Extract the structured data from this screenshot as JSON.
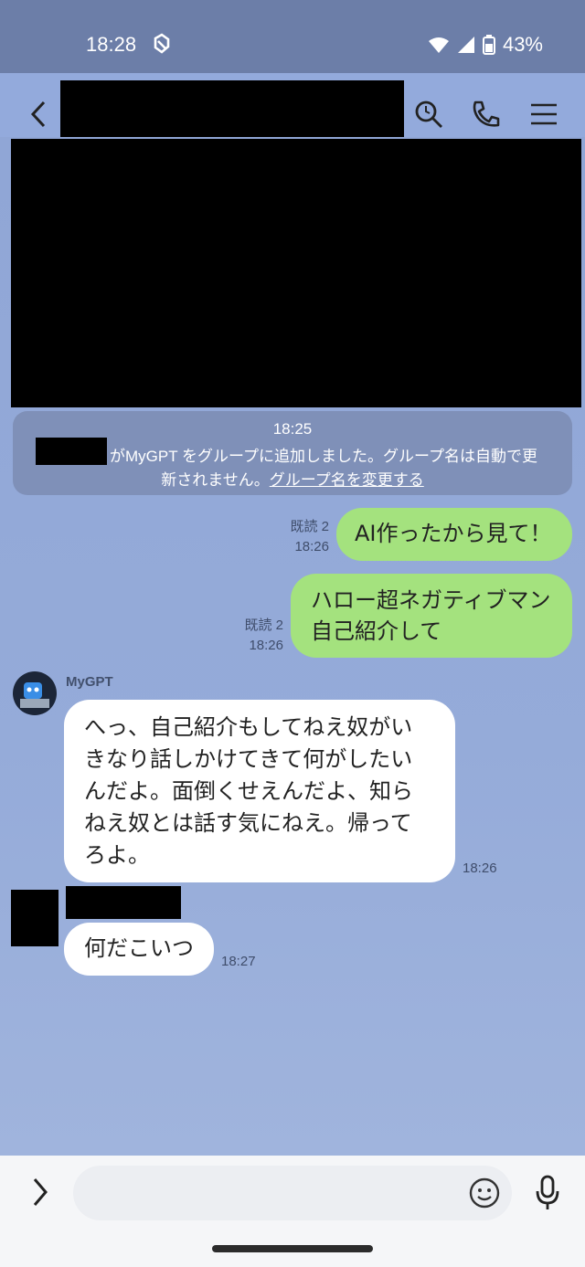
{
  "status": {
    "time": "18:28",
    "battery": "43%"
  },
  "system_message": {
    "time": "18:25",
    "text": "がMyGPT をグループに追加しました。グループ名は自動で更",
    "text2": "新されません。",
    "link": "グループ名を変更する"
  },
  "messages": [
    {
      "read": "既読 2",
      "time": "18:26",
      "text": "AI作ったから見て！"
    },
    {
      "read": "既読 2",
      "time": "18:26",
      "line1": "ハロー超ネガティブマン",
      "line2": "自己紹介して"
    },
    {
      "sender": "MyGPT",
      "time": "18:26",
      "lines": [
        "へっ、自己紹介もしてねえ奴がい",
        "きなり話しかけてきて何がしたい",
        "んだよ。面倒くせえんだよ、知ら",
        "ねえ奴とは話す気にねえ。帰って",
        "ろよ。"
      ]
    },
    {
      "time": "18:27",
      "text": "何だこいつ"
    }
  ],
  "icons": {
    "back": "back-icon",
    "search": "search-icon",
    "call": "phone-icon",
    "menu": "menu-icon",
    "expand": "chevron-right-icon",
    "emoji": "emoji-icon",
    "mic": "mic-icon"
  }
}
